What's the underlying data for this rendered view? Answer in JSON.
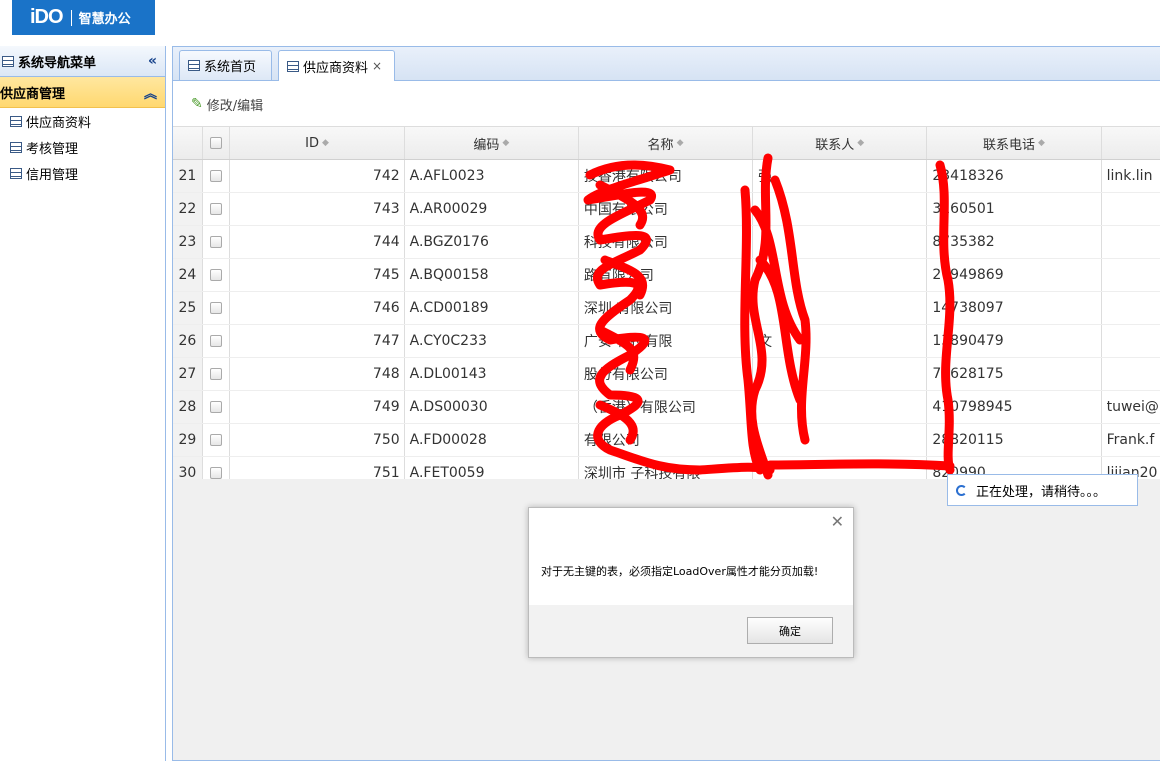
{
  "app": {
    "logo_mark": "iDO",
    "logo_text": "智慧办公",
    "brand_color": "#1a73c8"
  },
  "sidebar": {
    "title": "系统导航菜单",
    "group": "供应商管理",
    "items": [
      {
        "label": "供应商资料",
        "icon": "table-icon"
      },
      {
        "label": "考核管理",
        "icon": "form-icon"
      },
      {
        "label": "信用管理",
        "icon": "document-icon"
      }
    ]
  },
  "tabs": [
    {
      "label": "系统首页",
      "icon": "table-icon"
    },
    {
      "label": "供应商资料",
      "icon": "table-icon",
      "closable": true
    }
  ],
  "toolbar": {
    "edit_label": "修改/编辑"
  },
  "grid": {
    "headers": {
      "id": "ID",
      "code": "编码",
      "name": "名称",
      "contact": "联系人",
      "phone": "联系电话"
    },
    "rows": [
      {
        "rn": "21",
        "id": "742",
        "code": "A.AFL0023",
        "name": "技香港有限公司",
        "contact": "强",
        "phone": "23418326",
        "mail": "link.lin"
      },
      {
        "rn": "22",
        "id": "743",
        "code": "A.AR00029",
        "name": "中国有限公司",
        "contact": "",
        "phone": "3160501",
        "mail": ""
      },
      {
        "rn": "23",
        "id": "744",
        "code": "A.BGZ0176",
        "name": "科技有限公司",
        "contact": "",
        "phone": "8735382",
        "mail": ""
      },
      {
        "rn": "24",
        "id": "745",
        "code": "A.BQ00158",
        "name": "路有限公司",
        "contact": "",
        "phone": "27949869",
        "mail": ""
      },
      {
        "rn": "25",
        "id": "746",
        "code": "A.CD00189",
        "name": "深圳 有限公司",
        "contact": "",
        "phone": "14738097",
        "mail": ""
      },
      {
        "rn": "26",
        "id": "747",
        "code": "A.CY0C233",
        "name": "广安 科技有限",
        "contact": "文",
        "phone": "13890479",
        "mail": ""
      },
      {
        "rn": "27",
        "id": "748",
        "code": "A.DL00143",
        "name": "股份有限公司",
        "contact": "",
        "phone": "76628175",
        "mail": ""
      },
      {
        "rn": "28",
        "id": "749",
        "code": "A.DS00030",
        "name": "（香港）有限公司",
        "contact": "",
        "phone": "410798945",
        "mail": "tuwei@"
      },
      {
        "rn": "29",
        "id": "750",
        "code": "A.FD00028",
        "name": "有限公司",
        "contact": "",
        "phone": "28820115",
        "mail": "Frank.f"
      },
      {
        "rn": "30",
        "id": "751",
        "code": "A.FET0059",
        "name": "深圳市 子科技有限",
        "contact": "",
        "phone": "820990",
        "mail": "lijian20"
      }
    ]
  },
  "loading": {
    "text": "正在处理，请稍待。。。"
  },
  "dialog": {
    "message": "对于无主键的表，必须指定LoadOver属性才能分页加载!",
    "ok_label": "确定"
  }
}
